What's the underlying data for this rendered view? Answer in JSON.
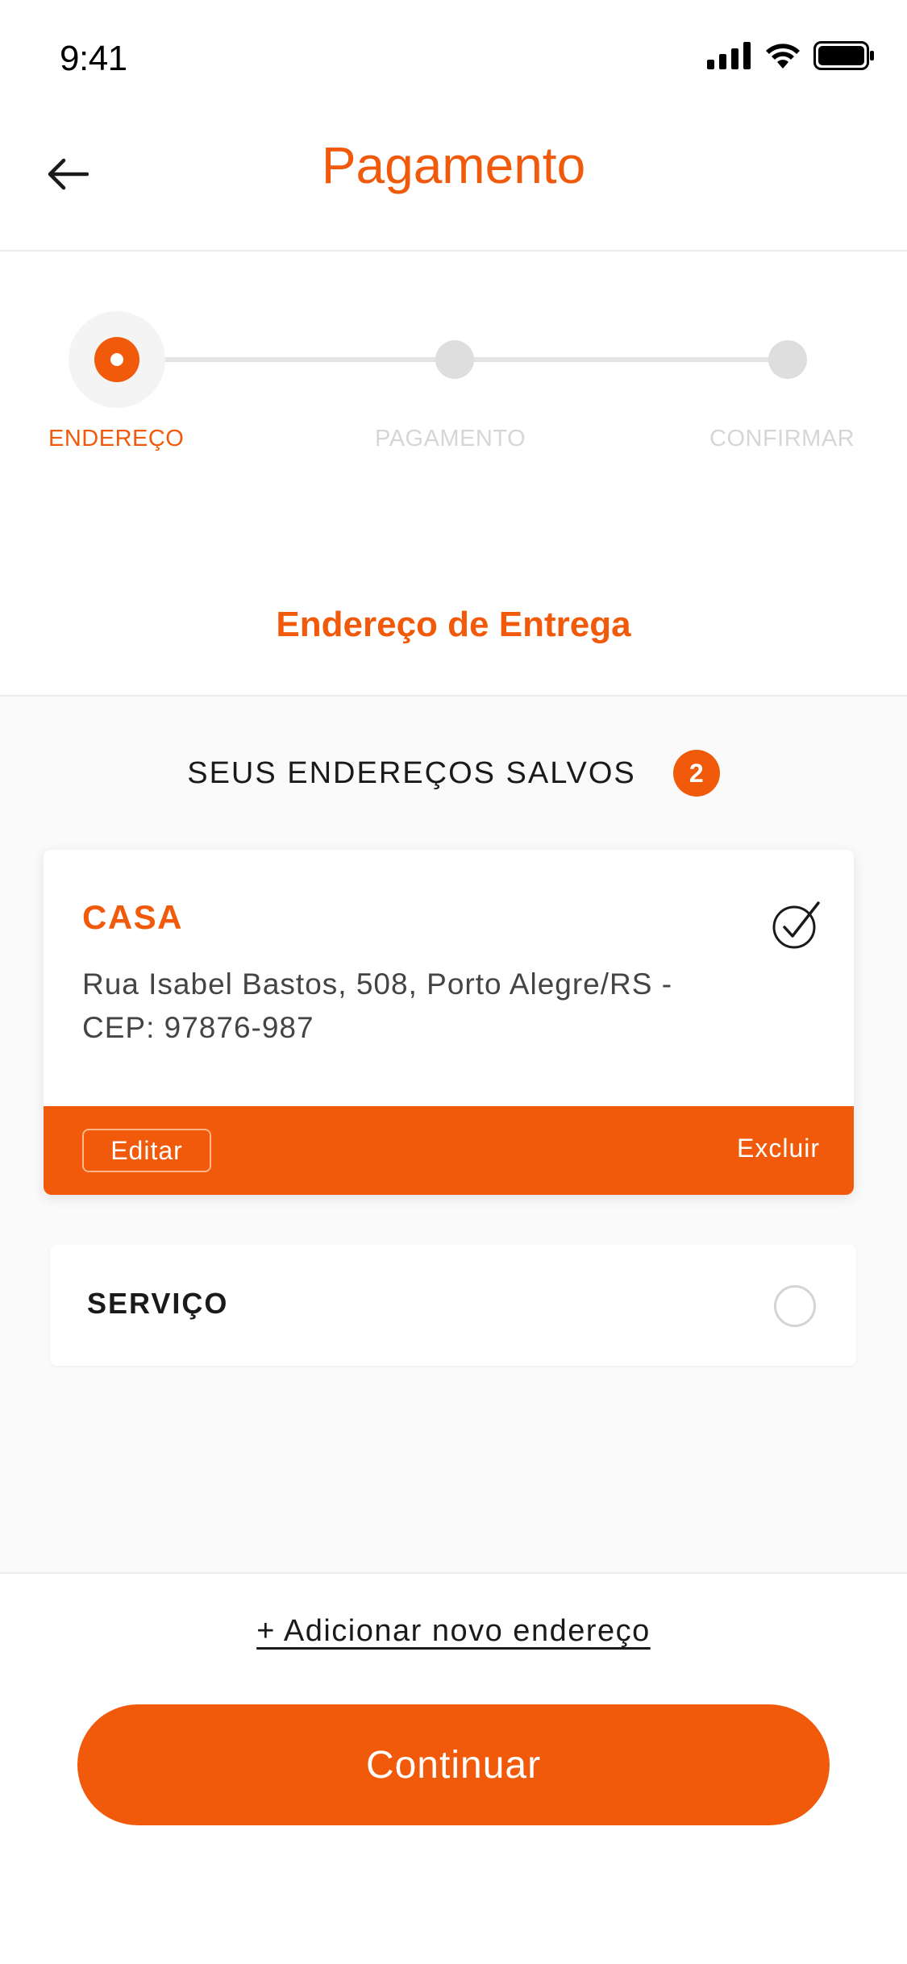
{
  "status_bar": {
    "time": "9:41",
    "icons": [
      "signal-icon",
      "wifi-icon",
      "battery-icon"
    ]
  },
  "navbar": {
    "title": "Pagamento",
    "back_icon": "arrow-left-icon"
  },
  "stepper": {
    "steps": [
      {
        "label": "ENDEREÇO",
        "state": "active"
      },
      {
        "label": "PAGAMENTO",
        "state": "inactive"
      },
      {
        "label": "CONFIRMAR",
        "state": "inactive"
      }
    ]
  },
  "section": {
    "title": "Endereço de Entrega"
  },
  "saved_addresses": {
    "title": "SEUS ENDEREÇOS SALVOS",
    "count": "2",
    "items": [
      {
        "name": "CASA",
        "address": "Rua Isabel Bastos, 508, Porto Alegre/RS - CEP: 97876-987",
        "selected": true,
        "edit_label": "Editar",
        "delete_label": "Excluir"
      },
      {
        "name": "SERVIÇO",
        "selected": false
      }
    ]
  },
  "actions": {
    "add_address": "+ Adicionar novo endereço",
    "continue": "Continuar"
  },
  "colors": {
    "accent": "#f05a0a",
    "inactive": "#dedede",
    "inactive_text": "#d6d6d6"
  }
}
